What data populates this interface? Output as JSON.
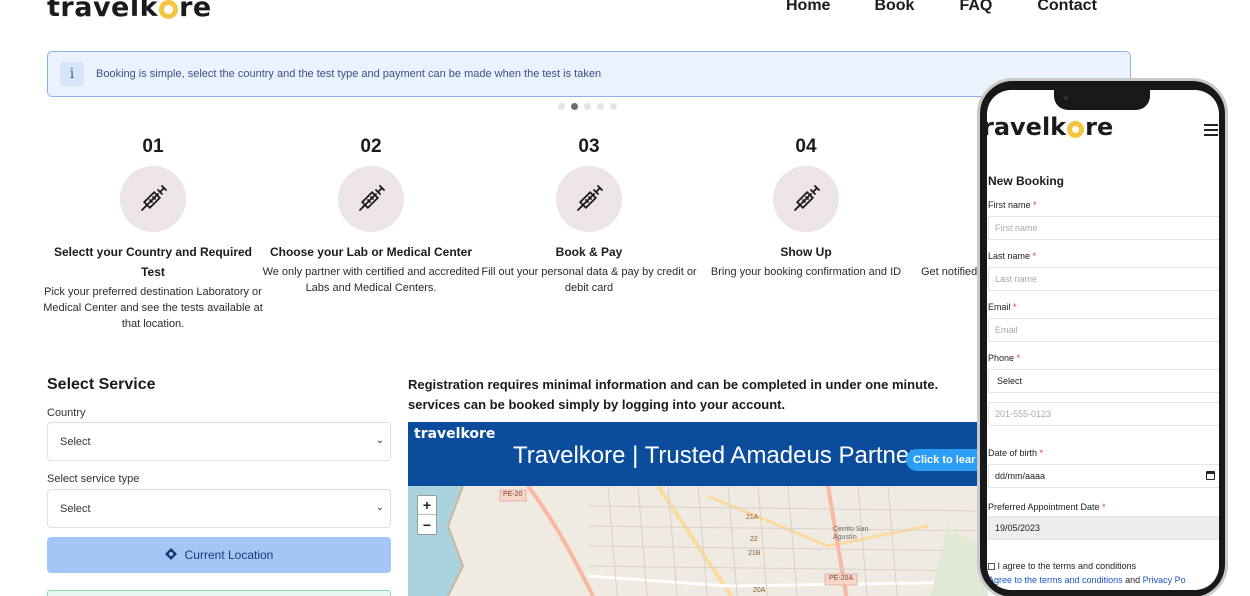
{
  "header": {
    "logo_prefix": "travelk",
    "logo_suffix": "re",
    "nav": [
      "Home",
      "Book",
      "FAQ",
      "Contact"
    ]
  },
  "alert": {
    "icon_label": "i",
    "text": "Booking is simple, select the country and the test type and payment can be made when the test is taken"
  },
  "carousel": {
    "total_dots": 5,
    "active_index": 1
  },
  "steps": [
    {
      "num": "01",
      "title": "Selectt your Country and Required Test",
      "desc": "Pick your preferred destination Laboratory or Medical Center and see the tests available at that location."
    },
    {
      "num": "02",
      "title": "Choose your Lab or Medical Center",
      "desc": "We only partner with certified and accredited Labs and Medical Centers."
    },
    {
      "num": "03",
      "title": "Book & Pay",
      "desc": "Fill out your personal data & pay by credit or debit card"
    },
    {
      "num": "04",
      "title": "Show Up",
      "desc": "Bring your booking confirmation and ID"
    },
    {
      "desc_partial": "Get notified"
    }
  ],
  "select_service": {
    "title": "Select Service",
    "country_label": "Country",
    "country_value": "Select",
    "service_label": "Select service type",
    "service_value": "Select",
    "location_button": "Current Location"
  },
  "registration": {
    "text": "Registration requires minimal information and can be completed in under one minute. services can be booked simply by logging into your account."
  },
  "banner": {
    "logo": "travelkore",
    "text": "Travelkore | Trusted Amadeus Partner",
    "button": "Click to lear"
  },
  "map": {
    "zoom_in": "+",
    "zoom_out": "−",
    "labels": [
      "PE-20",
      "PE-20A",
      "Cerrito San Agustín",
      "21A",
      "21B",
      "22",
      "20A"
    ]
  },
  "phone": {
    "logo_prefix": "ravelk",
    "logo_suffix": "re",
    "form_title": "New Booking",
    "first_name_label": "First name",
    "first_name_placeholder": "First name",
    "last_name_label": "Last name",
    "last_name_placeholder": "Last name",
    "email_label": "Email",
    "email_placeholder": "Email",
    "phone_label": "Phone",
    "phone_code_value": "Select",
    "phone_placeholder": "201-555-0123",
    "dob_label": "Date of birth",
    "dob_placeholder": "dd/mm/aaaa",
    "appt_label": "Preferred Appointment Date",
    "appt_value": "19/05/2023",
    "terms_checkbox": "I agree to the terms and conditions",
    "terms_link_1": "Agree to the terms and conditions",
    "terms_and": "and",
    "terms_link_2": "Privacy Po",
    "required_mark": "*"
  },
  "colors": {
    "alert_bg": "#eaf2fd",
    "alert_border": "#8db4ea",
    "button_bg": "#a3c6f7",
    "banner_bg": "#0b4d9c",
    "step_circle": "#ece4e5",
    "logo_accent": "#f4c542",
    "required": "#dc3545"
  }
}
